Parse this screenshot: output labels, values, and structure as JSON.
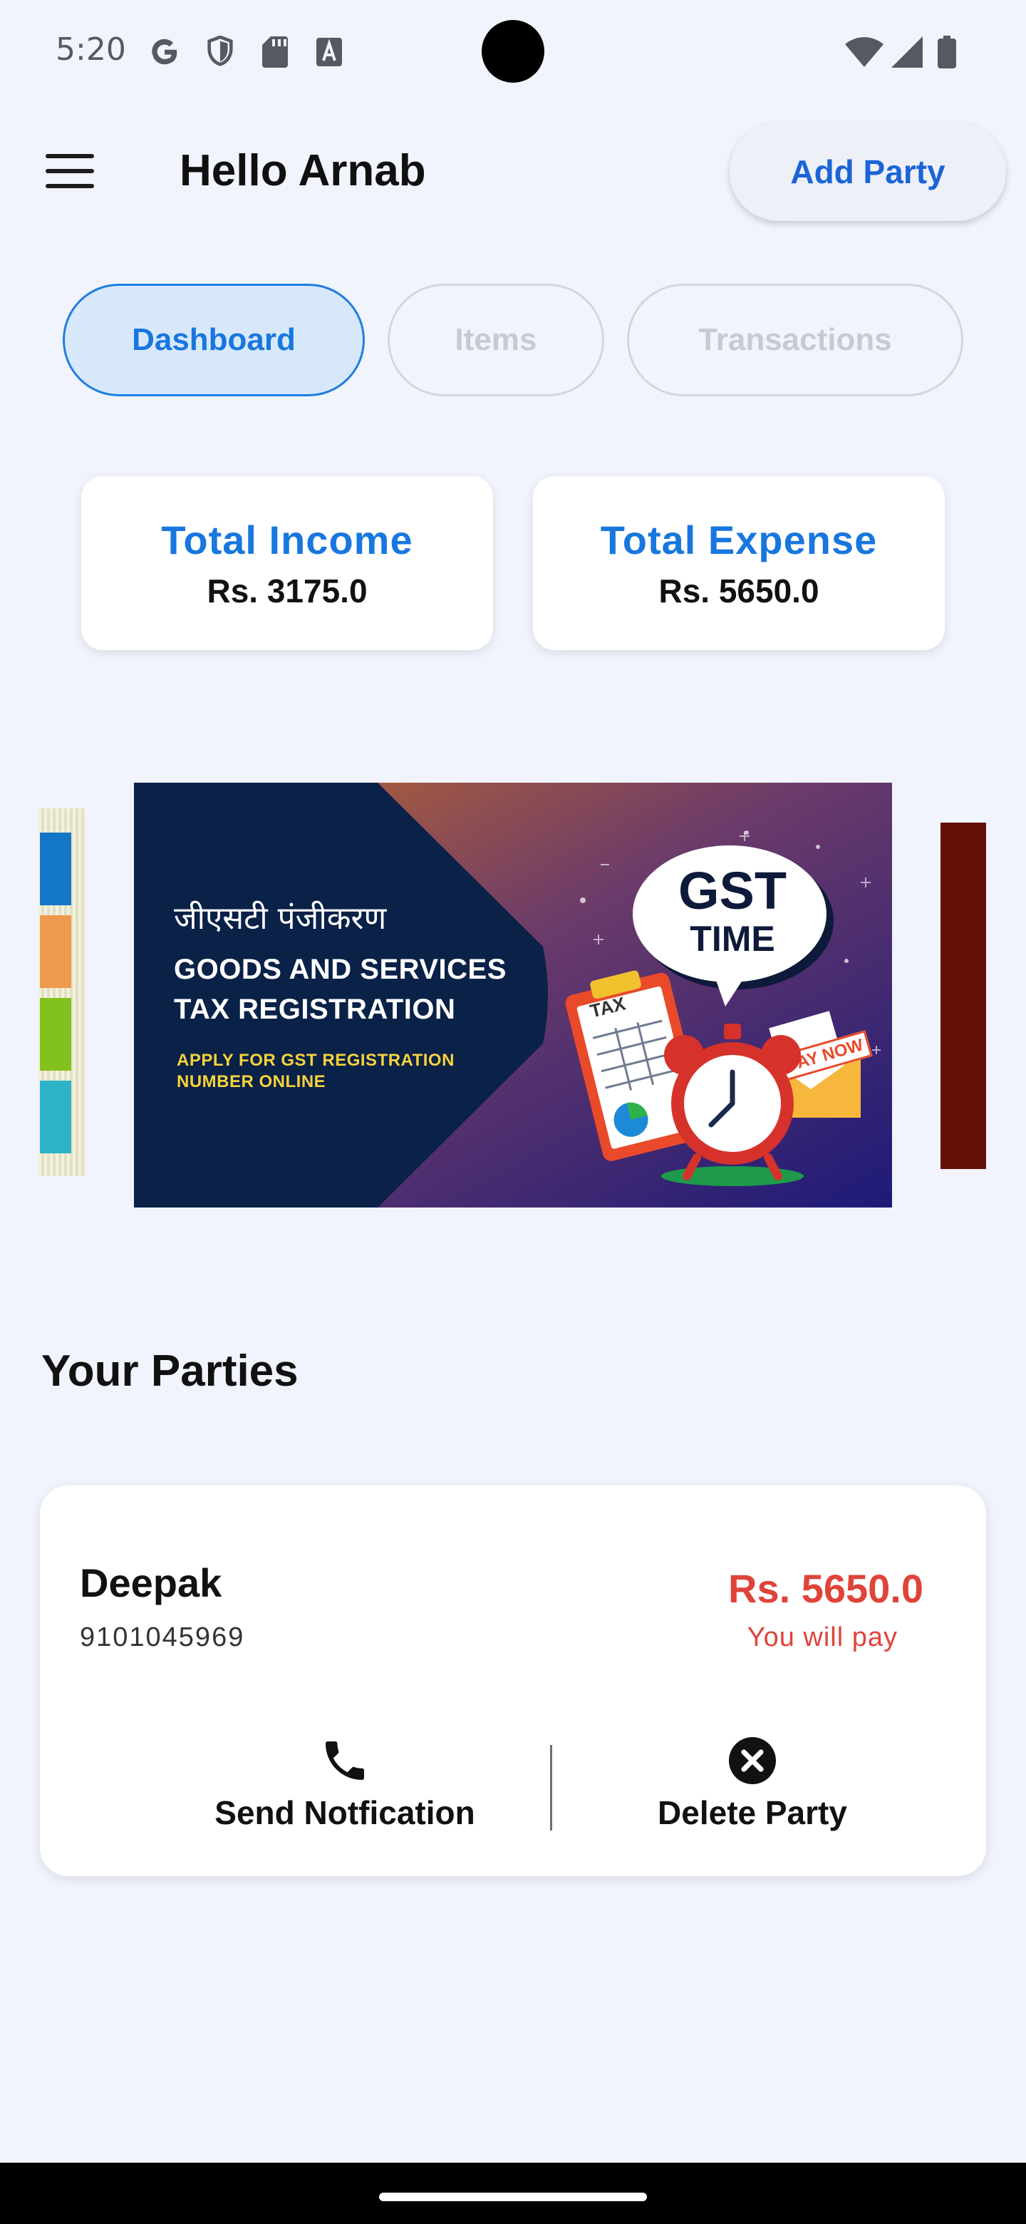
{
  "status_bar": {
    "time": "5:20",
    "left_icons": [
      "google-icon",
      "shield-icon",
      "sd-card-icon",
      "font-icon"
    ],
    "right_icons": [
      "wifi-icon",
      "cell-signal-icon",
      "battery-icon"
    ]
  },
  "app_bar": {
    "menu_icon": "menu-icon",
    "greeting": "Hello Arnab",
    "add_party_label": "Add Party"
  },
  "tabs": [
    {
      "label": "Dashboard",
      "active": true
    },
    {
      "label": "Items",
      "active": false
    },
    {
      "label": "Transactions",
      "active": false
    }
  ],
  "summary": {
    "income": {
      "title": "Total Income",
      "value": "Rs. 3175.0"
    },
    "expense": {
      "title": "Total Expense",
      "value": "Rs. 5650.0"
    }
  },
  "banner": {
    "hindi_title": "जीएसटी पंजीकरण",
    "title_line1": "GOODS AND SERVICES",
    "title_line2": "TAX REGISTRATION",
    "subtitle_line1": "APPLY FOR GST REGISTRATION",
    "subtitle_line2": "NUMBER ONLINE",
    "bubble_line1": "GST",
    "bubble_line2": "TIME",
    "tax_tag": "TAX",
    "pay_now": "PAY NOW"
  },
  "parties": {
    "section_title": "Your Parties",
    "items": [
      {
        "name": "Deepak",
        "phone": "9101045969",
        "amount": "Rs. 5650.0",
        "note": "You will pay",
        "send_label": "Send Notfication",
        "delete_label": "Delete Party"
      }
    ]
  },
  "colors": {
    "accent": "#1877de",
    "background": "#f1f4fc",
    "negative": "#e0433a"
  }
}
